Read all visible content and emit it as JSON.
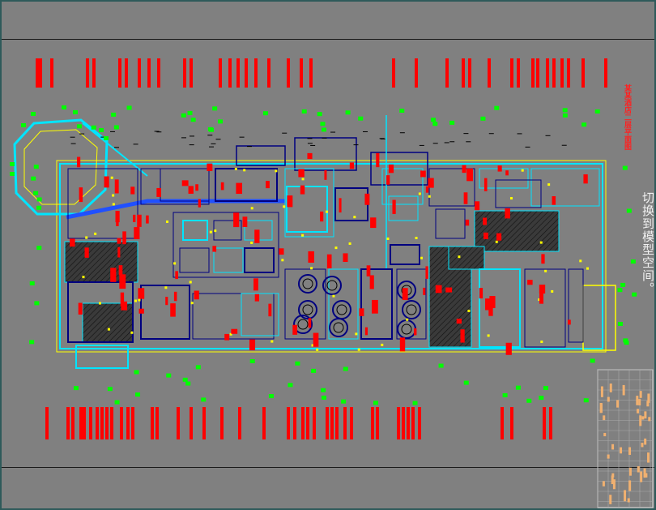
{
  "side_label": "切换到模型空间。",
  "drawing_title": "某某酒店二层平面图",
  "colors": {
    "background": "#808080",
    "wall": "#00e5ff",
    "grid": "#ffff00",
    "tag": "#ff0000",
    "dim": "#00ff00",
    "detail": "#000080",
    "hatch": "#3a3a3a",
    "table_fill": "#f0b070"
  }
}
